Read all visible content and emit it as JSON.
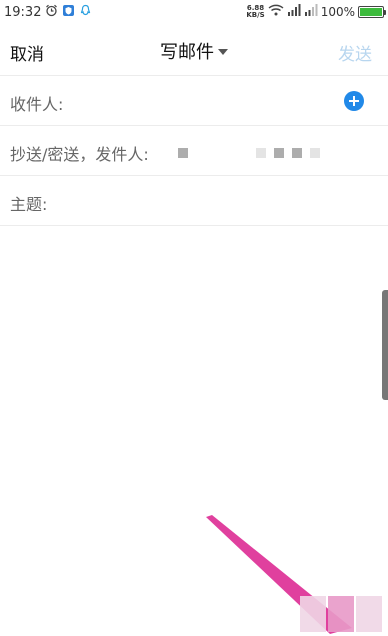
{
  "status_bar": {
    "time": "19:32",
    "net_speed_value": "6.88",
    "net_speed_unit": "KB/S",
    "battery": "100%",
    "icons": [
      "alarm-icon",
      "security-icon",
      "qq-icon",
      "wifi-icon",
      "signal-icon",
      "signal-2-icon",
      "battery-icon"
    ]
  },
  "header": {
    "cancel_label": "取消",
    "title": "写邮件",
    "send_label": "发送"
  },
  "fields": {
    "to_label": "收件人:",
    "cc_label": "抄送/密送，发件人:",
    "subject_label": "主题:"
  },
  "colors": {
    "accent": "#2189e8",
    "send_disabled": "#b8d6ef",
    "annotation_arrow": "#e0409e"
  }
}
